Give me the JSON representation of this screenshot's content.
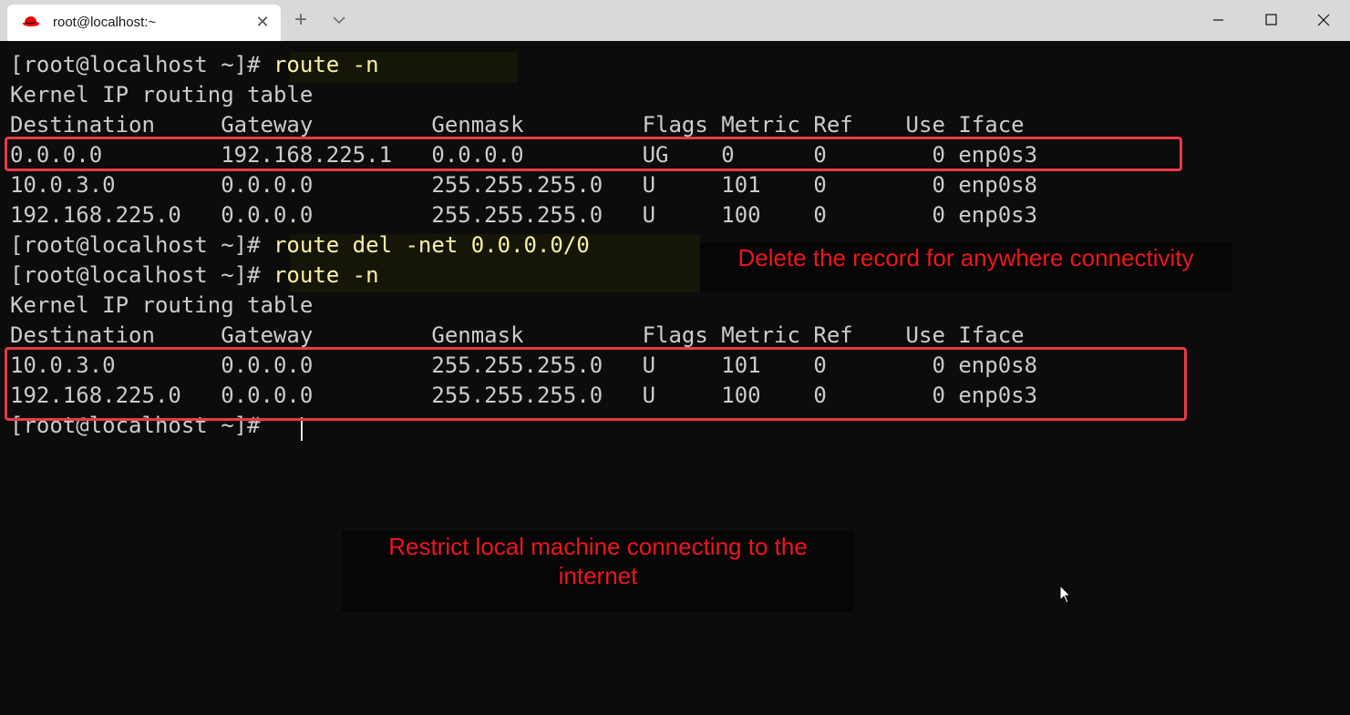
{
  "window": {
    "tab_title": "root@localhost:~",
    "tab_close_glyph": "✕",
    "new_tab_glyph": "+",
    "icons": {
      "tab_icon": "redhat-icon",
      "dropdown": "chevron-down-icon",
      "minimize": "minimize-icon",
      "maximize": "maximize-icon",
      "close": "close-icon"
    }
  },
  "terminal": {
    "prompt": "[root@localhost ~]# ",
    "commands": {
      "route_n": "route -n",
      "route_del": "route del -net 0.0.0.0/0"
    },
    "table_title": "Kernel IP routing table",
    "header": "Destination     Gateway         Genmask         Flags Metric Ref    Use Iface",
    "first_table_rows": [
      "0.0.0.0         192.168.225.1   0.0.0.0         UG    0      0        0 enp0s3",
      "10.0.3.0        0.0.0.0         255.255.255.0   U     101    0        0 enp0s8",
      "192.168.225.0   0.0.0.0         255.255.255.0   U     100    0        0 enp0s3"
    ],
    "second_table_rows": [
      "10.0.3.0        0.0.0.0         255.255.255.0   U     101    0        0 enp0s8",
      "192.168.225.0   0.0.0.0         255.255.255.0   U     100    0        0 enp0s3"
    ]
  },
  "annotations": {
    "delete_note": "Delete the record for anywhere connectivity",
    "restrict_note_line1": "Restrict local machine connecting to the",
    "restrict_note_line2": "internet"
  },
  "colors": {
    "terminal_bg": "#0c0c0c",
    "text": "#cccccc",
    "command": "#f9f1a5",
    "highlight_border": "#e83a44",
    "note_text": "#f0141e",
    "titlebar": "#d9d9d9"
  }
}
